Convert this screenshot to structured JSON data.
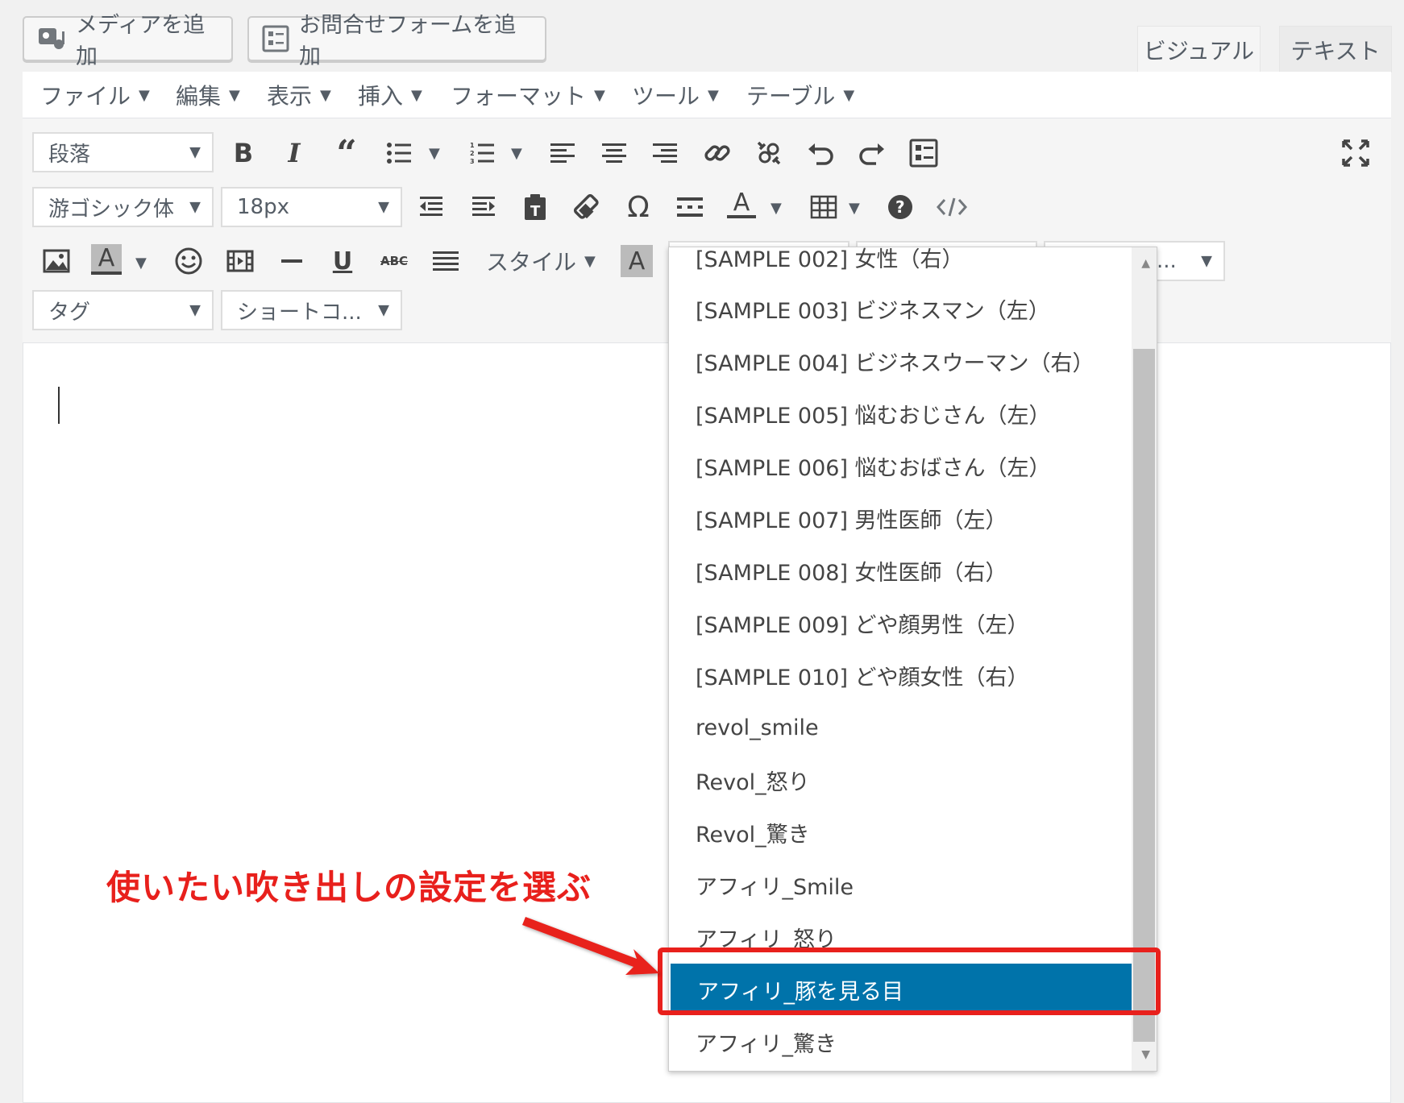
{
  "top_buttons": {
    "add_media": "メディアを追加",
    "add_contact_form": "お問合せフォームを追加"
  },
  "mode_tabs": {
    "visual": "ビジュアル",
    "text": "テキスト"
  },
  "menubar": {
    "file": "ファイル",
    "edit": "編集",
    "view": "表示",
    "insert": "挿入",
    "format": "フォーマット",
    "tools": "ツール",
    "table": "テーブル"
  },
  "toolbar": {
    "paragraph_select": "段落",
    "font_family_select": "游ゴシック体",
    "font_size_select": "18px",
    "style_label": "スタイル",
    "tag_select": "タグ",
    "shortcode_select": "ショートコ...",
    "hidden_select_fragment": "..."
  },
  "dropdown": {
    "partial_top_item": "[SAMPLE 002] 女性（右）",
    "items": [
      "[SAMPLE 003] ビジネスマン（左）",
      "[SAMPLE 004] ビジネスウーマン（右）",
      "[SAMPLE 005] 悩むおじさん（左）",
      "[SAMPLE 006] 悩むおばさん（左）",
      "[SAMPLE 007] 男性医師（左）",
      "[SAMPLE 008] 女性医師（右）",
      "[SAMPLE 009] どや顔男性（左）",
      "[SAMPLE 010] どや顔女性（右）",
      "revol_smile",
      "Revol_怒り",
      "Revol_驚き",
      "アフィリ_Smile",
      "アフィリ_怒り",
      "アフィリ_豚を見る目",
      "アフィリ_驚き"
    ],
    "selected_index": 13
  },
  "annotation": {
    "text": "使いたい吹き出しの設定を選ぶ"
  },
  "colors": {
    "accent_blue": "#0073aa",
    "annotation_red": "#e8201c"
  }
}
